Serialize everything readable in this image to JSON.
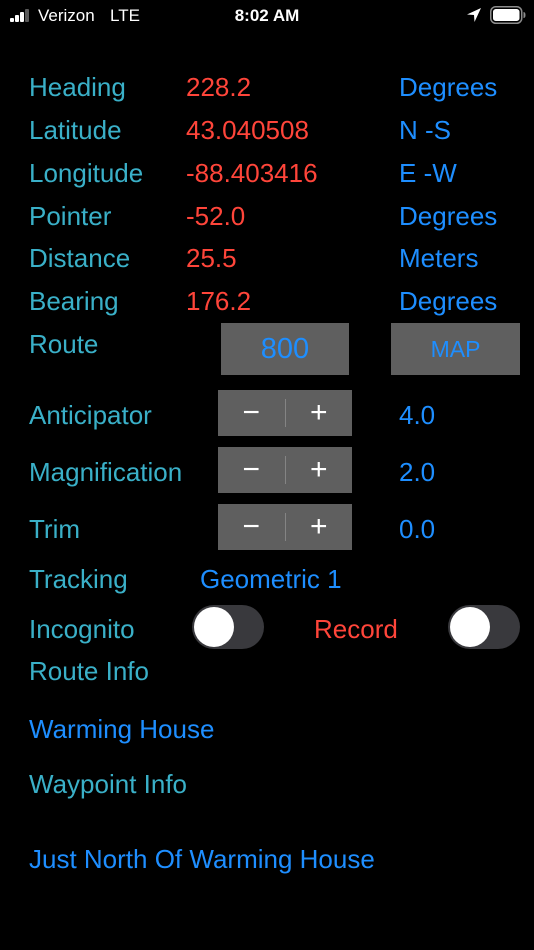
{
  "status_bar": {
    "carrier": "Verizon",
    "network": "LTE",
    "time": "8:02 AM",
    "signal_bars_active": 3,
    "signal_bars_total": 4,
    "battery_level": 1.0,
    "icons": [
      "signal-icon",
      "location-arrow-icon",
      "battery-icon"
    ]
  },
  "readouts": [
    {
      "label": "Heading",
      "value": "228.2",
      "unit": "Degrees"
    },
    {
      "label": "Latitude",
      "value": "43.040508",
      "unit": "N -S"
    },
    {
      "label": "Longitude",
      "value": "-88.403416",
      "unit": "E -W"
    },
    {
      "label": "Pointer",
      "value": "-52.0",
      "unit": "Degrees"
    },
    {
      "label": "Distance",
      "value": "25.5",
      "unit": "Meters"
    },
    {
      "label": "Bearing",
      "value": "176.2",
      "unit": "Degrees"
    }
  ],
  "route": {
    "label": "Route",
    "number": "800",
    "map_button": "MAP"
  },
  "steppers": [
    {
      "label": "Anticipator",
      "value": "4.0",
      "minus": "−",
      "plus": "+"
    },
    {
      "label": "Magnification",
      "value": "2.0",
      "minus": "−",
      "plus": "+"
    },
    {
      "label": "Trim",
      "value": "0.0",
      "minus": "−",
      "plus": "+"
    }
  ],
  "tracking": {
    "label": "Tracking",
    "value": "Geometric 1"
  },
  "incognito": {
    "label": "Incognito",
    "on": false
  },
  "record": {
    "label": "Record",
    "on": false
  },
  "route_info": {
    "label": "Route Info",
    "value": "Warming House"
  },
  "waypoint_info": {
    "label": "Waypoint Info",
    "value": "Just North Of Warming House"
  },
  "colors": {
    "background": "#000000",
    "label": "#3ab0c8",
    "value_red": "#ff453a",
    "accent_blue": "#1e8eff",
    "button_gray": "#5f5f5f",
    "switch_off": "#39393d"
  }
}
